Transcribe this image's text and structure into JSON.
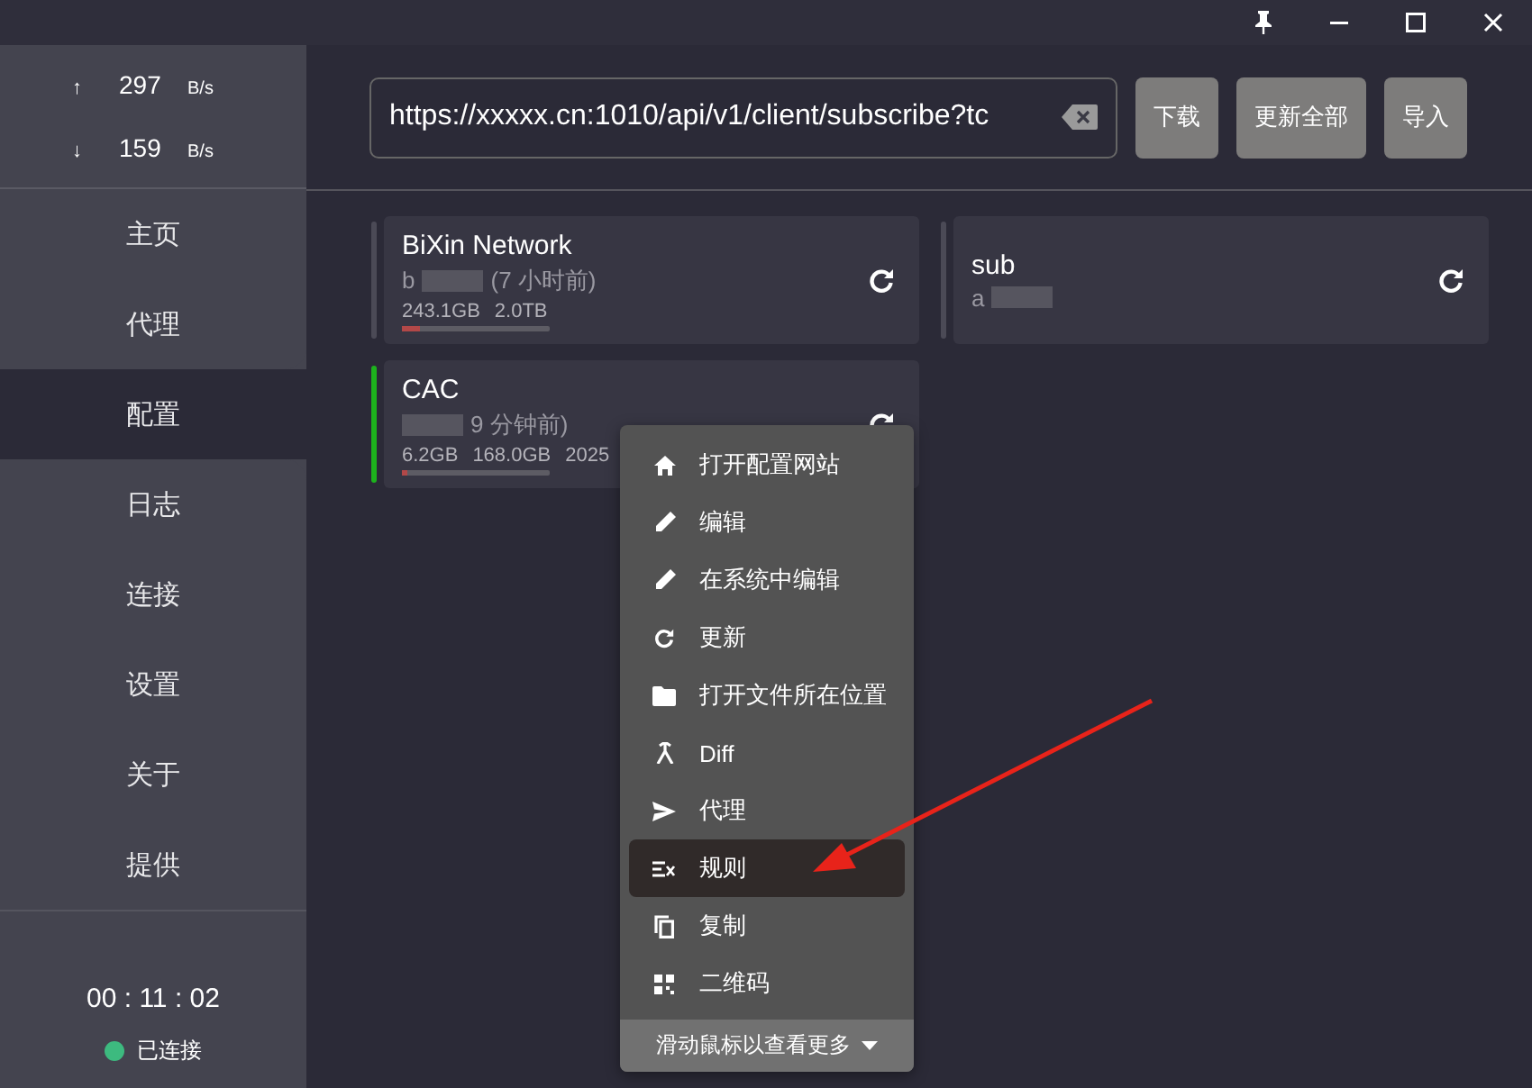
{
  "traffic": [
    {
      "arrow": "↑",
      "value": "297",
      "unit": "B/s"
    },
    {
      "arrow": "↓",
      "value": "159",
      "unit": "B/s"
    }
  ],
  "nav": [
    {
      "label": "主页",
      "selected": false
    },
    {
      "label": "代理",
      "selected": false
    },
    {
      "label": "配置",
      "selected": true
    },
    {
      "label": "日志",
      "selected": false
    },
    {
      "label": "连接",
      "selected": false
    },
    {
      "label": "设置",
      "selected": false
    },
    {
      "label": "关于",
      "selected": false
    },
    {
      "label": "提供",
      "selected": false
    }
  ],
  "timer": "00 : 11 : 02",
  "status": {
    "label": "已连接",
    "connected": true
  },
  "subscription": {
    "url": "https://xxxxx.cn:1010/api/v1/client/subscribe?tc",
    "buttons": [
      "下载",
      "更新全部",
      "导入"
    ]
  },
  "profiles": [
    {
      "name": "BiXin Network",
      "selected": false,
      "description": [
        {
          "kind": "text",
          "text": "b"
        },
        {
          "kind": "redacted"
        },
        {
          "kind": "text",
          "text": "(7 小时前)"
        }
      ],
      "stats": [
        "243.1GB",
        "2.0TB"
      ],
      "level": 0.12
    },
    {
      "name": "sub",
      "selected": false,
      "description": [
        {
          "kind": "text",
          "text": "a"
        },
        {
          "kind": "redacted"
        }
      ]
    },
    {
      "name": "CAC",
      "selected": true,
      "description": [
        {
          "kind": "redacted"
        },
        {
          "kind": "text",
          "text": "9 分钟前)"
        }
      ],
      "stats": [
        "6.2GB",
        "168.0GB",
        "2025"
      ],
      "level": 0.04
    }
  ],
  "context_menu": {
    "items": [
      {
        "label": "打开配置网站",
        "kind": "home",
        "selected": false
      },
      {
        "label": "编辑",
        "kind": "pencil",
        "selected": false
      },
      {
        "label": "在系统中编辑",
        "kind": "pencil",
        "selected": false
      },
      {
        "label": "更新",
        "kind": "refresh",
        "selected": false
      },
      {
        "label": "打开文件所在位置",
        "kind": "folder",
        "selected": false
      },
      {
        "label": "Diff",
        "kind": "diff",
        "selected": false
      },
      {
        "label": "代理",
        "kind": "send",
        "selected": false
      },
      {
        "label": "规则",
        "kind": "rules",
        "selected": true
      },
      {
        "label": "复制",
        "kind": "copy",
        "selected": false
      },
      {
        "label": "二维码",
        "kind": "qr",
        "selected": false
      }
    ],
    "footer": "滑动鼠标以查看更多"
  }
}
